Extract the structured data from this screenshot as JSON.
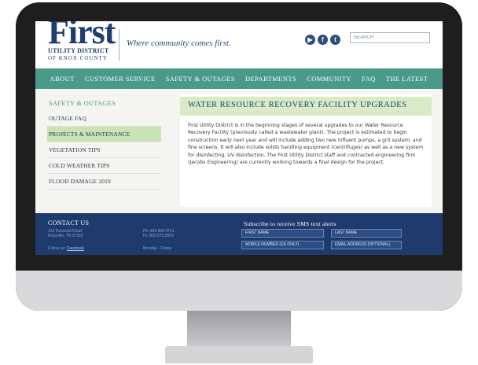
{
  "header": {
    "logo_first": "First",
    "logo_line2": "UTILITY DISTRICT",
    "logo_line3": "OF KNOX COUNTY",
    "tagline": "Where community comes first.",
    "social_icons": [
      "youtube-icon",
      "facebook-icon",
      "twitter-icon"
    ],
    "search_placeholder": "SEARCH"
  },
  "nav": {
    "items": [
      "ABOUT",
      "CUSTOMER SERVICE",
      "SAFETY & OUTAGES",
      "DEPARTMENTS",
      "COMMUNITY",
      "FAQ",
      "THE LATEST"
    ]
  },
  "sidebar": {
    "heading": "SAFETY & OUTAGES",
    "items": [
      "OUTAGE FAQ",
      "PROJECTS & MAINTENANCE",
      "VEGETATION TIPS",
      "COLD WEATHER TIPS",
      "FLOOD DAMAGE 2019"
    ],
    "active_index": 1
  },
  "main": {
    "title": "WATER RESOURCE RECOVERY FACILITY UPGRADES",
    "body": "First Utility District is in the beginning stages of several upgrades to our Water Resource Recovery Facility (previously called a wastewater plant). The project is estimated to begin construction early next year and will include adding two new influent pumps, a grit system, and fine screens. It will also include solids handling equipment (centrifuges) as well as a new system for disinfecting, UV disinfection. The First Utility District staff and contracted engineering firm (Jacobs Engineering) are currently working towards a final design for the project."
  },
  "footer": {
    "contact_title": "CONTACT US",
    "address_line1": "122 Durwood Road",
    "address_line2": "Knoxville, TN 37922",
    "phone_line1": "Ph: 865.966.9741",
    "phone_line2": "Fx: 865.675.9955",
    "follow_prefix": "Follow us:",
    "follow_link": "Facebook",
    "hours": "Monday - Friday",
    "sms_title": "Subscribe to receive SMS text alerts",
    "fields": {
      "first_name": "FIRST NAME",
      "last_name": "LAST NAME",
      "mobile": "MOBILE NUMBER (US ONLY)",
      "email": "EMAIL ADDRESS (OPTIONAL)"
    }
  },
  "colors": {
    "brand_navy": "#1e3f6e",
    "nav_teal": "#4a9a8a",
    "sidebar_active": "#c8e3b4",
    "title_bar": "#d8ebc6",
    "footer_bg": "#1f3b6e"
  }
}
